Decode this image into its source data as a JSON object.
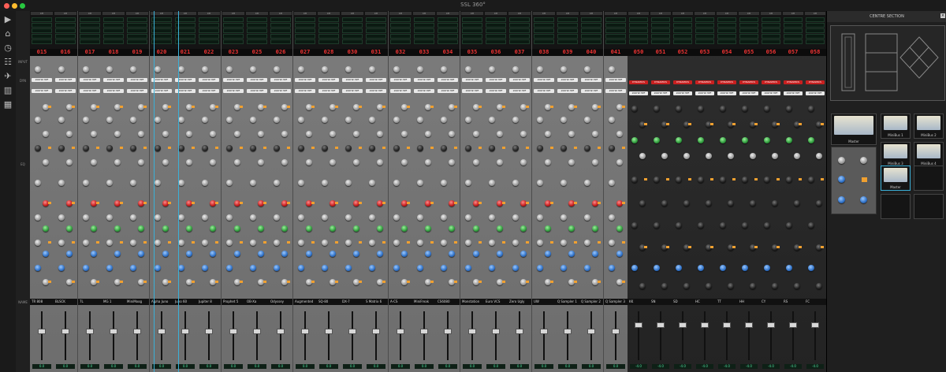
{
  "window": {
    "title": "SSL 360°"
  },
  "toolbar": {
    "icons": [
      "play-icon",
      "home-icon",
      "clock-icon",
      "mixer-icon",
      "plane-icon",
      "bars-icon",
      "grid-icon"
    ]
  },
  "row_labels": {
    "input": "INPUT",
    "dyn": "DYN",
    "eq": "EQ",
    "name": "NAME"
  },
  "channels": [
    {
      "num": "015",
      "name": "TR 808"
    },
    {
      "num": "016",
      "name": "BLSCK"
    },
    {
      "num": "017",
      "name": "7L"
    },
    {
      "num": "018",
      "name": "MG 1"
    },
    {
      "num": "019",
      "name": "MiniMoog"
    },
    {
      "num": "020",
      "name": "Alpha Juno"
    },
    {
      "num": "021",
      "name": "Juno 60"
    },
    {
      "num": "022",
      "name": "Jupiter 8"
    },
    {
      "num": "023",
      "name": "Prophet 5"
    },
    {
      "num": "025",
      "name": "OB-Xa"
    },
    {
      "num": "026",
      "name": "Odyssey"
    },
    {
      "num": "027",
      "name": "Augmented"
    },
    {
      "num": "028",
      "name": "SQ-80"
    },
    {
      "num": "030",
      "name": "DX-7"
    },
    {
      "num": "031",
      "name": "S Matrix 6"
    },
    {
      "num": "032",
      "name": "A-CS"
    },
    {
      "num": "033",
      "name": "MiniFreak"
    },
    {
      "num": "034",
      "name": "CS6080"
    },
    {
      "num": "035",
      "name": "Monstation"
    },
    {
      "num": "036",
      "name": "Euro VCS"
    },
    {
      "num": "037",
      "name": "Zero Ugly"
    },
    {
      "num": "038",
      "name": "UW"
    },
    {
      "num": "039",
      "name": "Q Sampler 1"
    },
    {
      "num": "040",
      "name": "Q Sampler 2"
    },
    {
      "num": "041",
      "name": "Q Sampler 3"
    }
  ],
  "dark_channels": [
    {
      "num": "050",
      "name": "KK"
    },
    {
      "num": "051",
      "name": "SN"
    },
    {
      "num": "052",
      "name": "SD"
    },
    {
      "num": "053",
      "name": "HC"
    },
    {
      "num": "054",
      "name": "TT"
    },
    {
      "num": "055",
      "name": "HH"
    },
    {
      "num": "056",
      "name": "CY"
    },
    {
      "num": "057",
      "name": "RS"
    },
    {
      "num": "058",
      "name": "FC"
    }
  ],
  "strip": {
    "chip_value": "200HZ HPF",
    "dyn_label": "DYNAMICS",
    "fader_value": "0.0",
    "dark_fader_value": "-4.0"
  },
  "centre": {
    "title": "CENTRE SECTION",
    "master_label": "Master",
    "minibus": [
      "MiniBus 1",
      "MiniBus 2",
      "MiniBus 3",
      "MiniBus 4"
    ],
    "master_select": "Master"
  },
  "colors": {
    "knob_red": "#c21a1a",
    "knob_green": "#2f9a3c",
    "knob_blue": "#2e70c6",
    "display_red": "#e33333",
    "accent_orange": "#f0a030",
    "select_cyan": "#3ab0d8"
  }
}
